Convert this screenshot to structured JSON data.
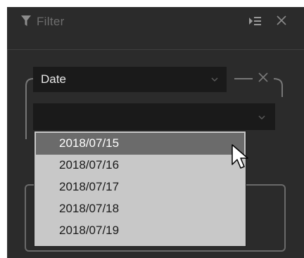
{
  "panel": {
    "title": "Filter",
    "icons": {
      "funnel": "funnel-icon",
      "collapse": "collapse-panel-icon",
      "close": "close-icon"
    }
  },
  "filter": {
    "field_label": "Date",
    "value_label": "",
    "remove_icon": "close-icon"
  },
  "dropdown": {
    "options": [
      "2018/07/15",
      "2018/07/16",
      "2018/07/17",
      "2018/07/18",
      "2018/07/19"
    ],
    "selected_index": 0
  },
  "colors": {
    "panel_bg": "#2b2b2b",
    "field_bg": "#1a1a1a",
    "dropdown_bg": "#c8c8c8",
    "selected_bg": "#6b6b6b"
  }
}
